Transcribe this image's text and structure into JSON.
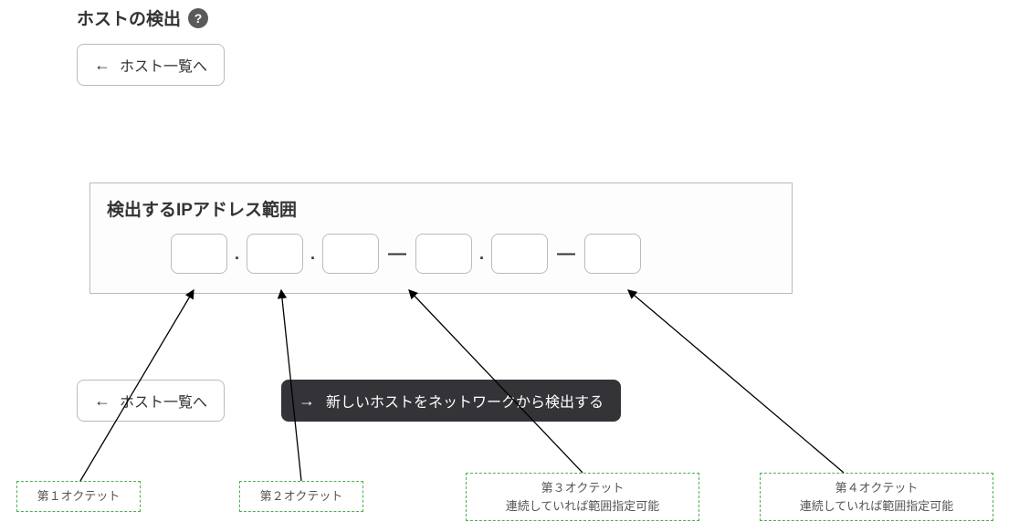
{
  "header": {
    "title": "ホストの検出",
    "help_icon_label": "?"
  },
  "buttons": {
    "back_to_list": "ホスト一覧へ",
    "detect_hosts": "新しいホストをネットワークから検出する"
  },
  "ip_range": {
    "title": "検出するIPアドレス範囲",
    "octet1": "",
    "octet2": "",
    "octet3a": "",
    "octet3b": "",
    "octet4a": "",
    "octet4b": ""
  },
  "annotations": {
    "octet1": "第１オクテット",
    "octet2": "第２オクテット",
    "octet3": "第３オクテット\n連続していれば範囲指定可能",
    "octet4": "第４オクテット\n連続していれば範囲指定可能"
  }
}
